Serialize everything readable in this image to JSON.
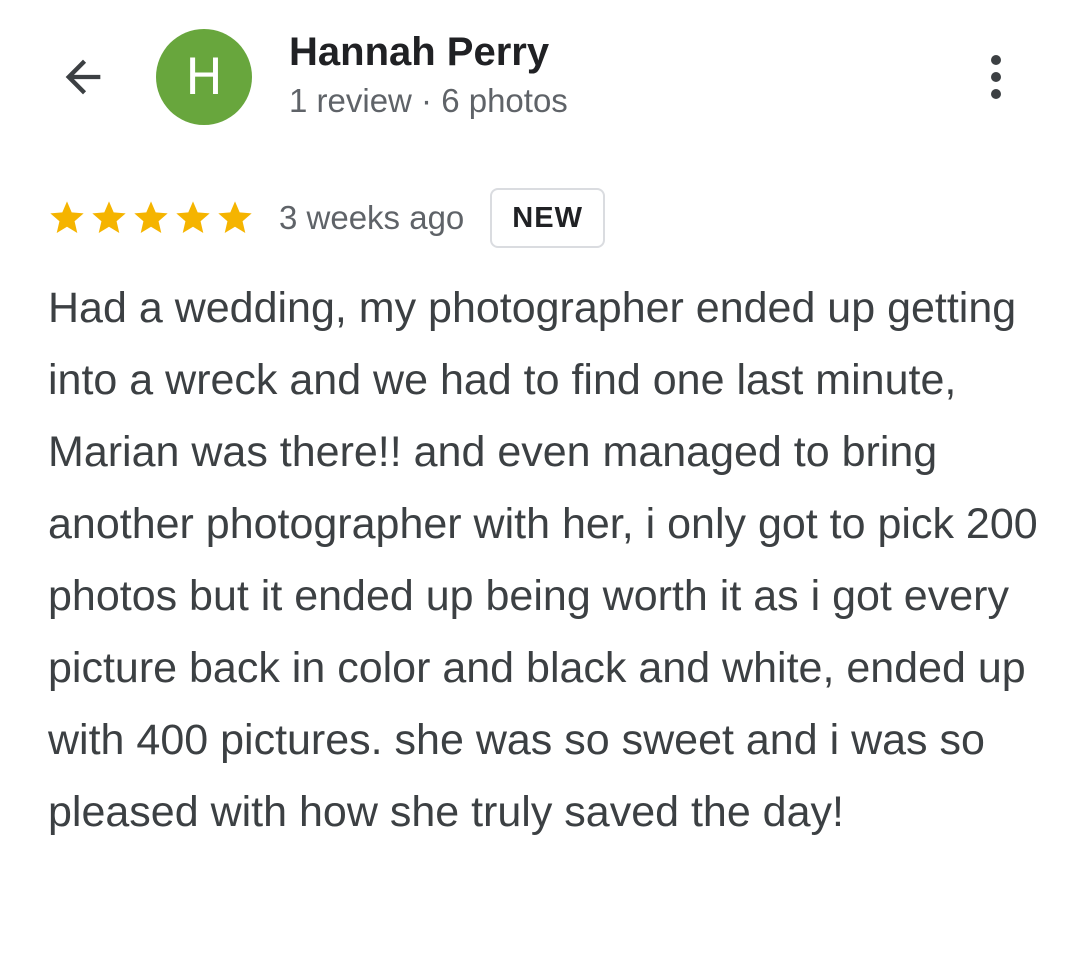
{
  "header": {
    "back_icon": "arrow-back-icon",
    "avatar_initial": "H",
    "avatar_color": "#68a63d",
    "reviewer_name": "Hannah Perry",
    "reviewer_stats": "1 review · 6 photos",
    "more_icon": "more-vert-icon"
  },
  "review": {
    "rating": 5,
    "max_rating": 5,
    "star_color": "#f5b400",
    "time_ago": "3 weeks ago",
    "badge": "NEW",
    "text": "Had a wedding, my photographer ended up getting into a wreck and we had to find one last minute, Marian was there!! and even managed to bring another photographer with her, i only got to pick 200 photos but it ended up being worth it as i got every picture back in color and black and white, ended up with 400 pictures. she was so sweet and i was so pleased with how she truly saved the day!"
  }
}
